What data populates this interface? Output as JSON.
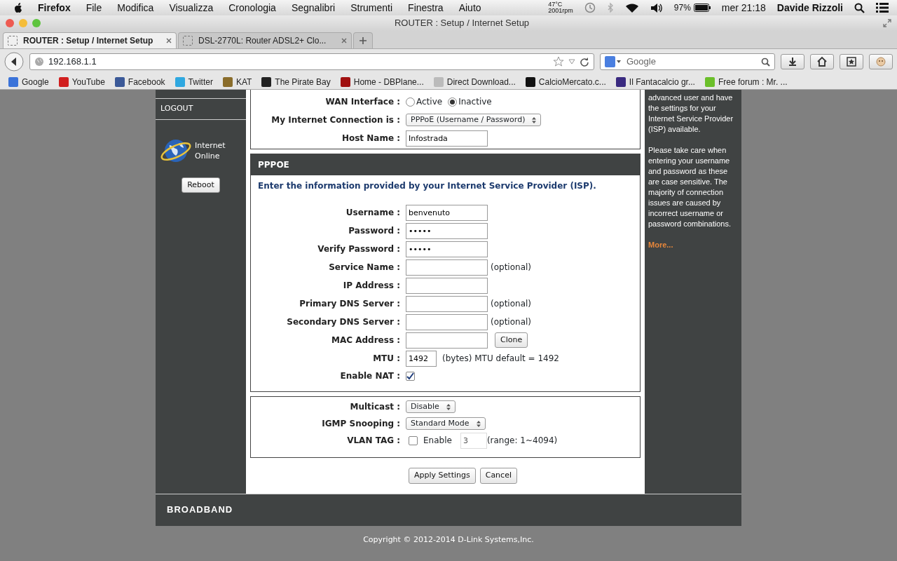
{
  "menubar": {
    "app": "Firefox",
    "menus": [
      "File",
      "Modifica",
      "Visualizza",
      "Cronologia",
      "Segnalibri",
      "Strumenti",
      "Finestra",
      "Aiuto"
    ],
    "temperature": "47°C",
    "fan": "2001rpm",
    "battery": "97%",
    "clock": "mer 21:18",
    "user": "Davide Rizzoli"
  },
  "window": {
    "title": "ROUTER : Setup / Internet Setup"
  },
  "tabs": [
    {
      "label": "ROUTER : Setup / Internet Setup",
      "selected": true
    },
    {
      "label": "DSL-2770L: Router ADSL2+ Clo...",
      "selected": false
    }
  ],
  "address_bar": {
    "value": "192.168.1.1"
  },
  "search": {
    "placeholder": "Google"
  },
  "bookmarks": [
    {
      "label": "Google",
      "color": "#3b73d9"
    },
    {
      "label": "YouTube",
      "color": "#d11f1f"
    },
    {
      "label": "Facebook",
      "color": "#3b5998"
    },
    {
      "label": "Twitter",
      "color": "#2fa8e0"
    },
    {
      "label": "KAT",
      "color": "#8a6d2b"
    },
    {
      "label": "The Pirate Bay",
      "color": "#222222"
    },
    {
      "label": "Home - DBPlane...",
      "color": "#a01010"
    },
    {
      "label": "Direct Download...",
      "color": "#bbbbbb"
    },
    {
      "label": "CalcioMercato.c...",
      "color": "#111111"
    },
    {
      "label": "Il Fantacalcio gr...",
      "color": "#3a2a80"
    },
    {
      "label": "Free forum : Mr. ...",
      "color": "#6bbf2a"
    }
  ],
  "sidebar": {
    "items": [
      "LOGOUT"
    ],
    "status": "Internet Online",
    "reboot": "Reboot"
  },
  "wan": {
    "fields": [
      {
        "kind": "radio",
        "label": "WAN Interface :",
        "options": [
          {
            "label": "Active",
            "selected": false
          },
          {
            "label": "Inactive",
            "selected": true
          }
        ]
      },
      {
        "kind": "select",
        "label": "My Internet Connection is :",
        "value": "PPPoE (Username / Password)"
      },
      {
        "kind": "text",
        "label": "Host Name :",
        "value": "Infostrada"
      }
    ]
  },
  "pppoe": {
    "title": "PPPOE",
    "intro": "Enter the information provided by your Internet Service Provider (ISP).",
    "fields": [
      {
        "kind": "text",
        "label": "Username :",
        "value": "benvenuto"
      },
      {
        "kind": "text",
        "label": "Password :",
        "value": "•••••"
      },
      {
        "kind": "text",
        "label": "Verify Password :",
        "value": "•••••"
      },
      {
        "kind": "text",
        "label": "Service Name :",
        "note": "(optional)"
      },
      {
        "kind": "text",
        "label": "IP Address :"
      },
      {
        "kind": "text",
        "label": "Primary DNS Server :",
        "note": "(optional)"
      },
      {
        "kind": "text",
        "label": "Secondary DNS Server :",
        "note": "(optional)"
      },
      {
        "kind": "text",
        "label": "MAC Address :",
        "button": "Clone"
      },
      {
        "kind": "short",
        "label": "MTU :",
        "value": "1492",
        "note": "(bytes) MTU default = 1492"
      },
      {
        "kind": "checkbox",
        "label": "Enable NAT :",
        "checked": true
      }
    ]
  },
  "multicast": {
    "fields": [
      {
        "kind": "select",
        "label": "Multicast :",
        "value": "Disable"
      },
      {
        "kind": "select",
        "label": "IGMP Snooping :",
        "value": "Standard Mode"
      },
      {
        "kind": "vlan",
        "label": "VLAN TAG :",
        "checked": false,
        "check_label": "Enable",
        "value": "3",
        "note": "(range: 1~4094)"
      }
    ]
  },
  "buttons": [
    "Apply Settings",
    "Cancel"
  ],
  "help": {
    "paragraphs": [
      "advanced user and have the settings for your Internet Service Provider (ISP) available.",
      "Please take care when entering your username and password as these are case sensitive. The majority of connection issues are caused by incorrect username or password combinations."
    ],
    "link": "More..."
  },
  "footer": {
    "brand": "BROADBAND",
    "copyright": "Copyright © 2012-2014 D-Link Systems,Inc."
  }
}
